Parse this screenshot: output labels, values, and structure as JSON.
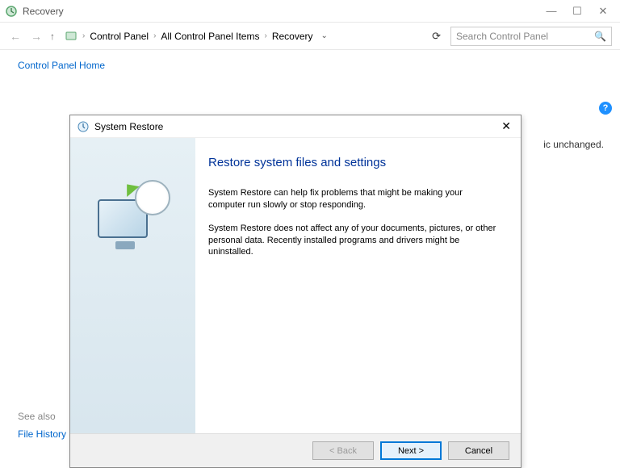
{
  "window": {
    "title": "Recovery",
    "controls": {
      "min": "—",
      "max": "☐",
      "close": "✕"
    }
  },
  "nav": {
    "breadcrumb": [
      "Control Panel",
      "All Control Panel Items",
      "Recovery"
    ],
    "search_placeholder": "Search Control Panel"
  },
  "left": {
    "home": "Control Panel Home",
    "see_also": "See also",
    "file_history": "File History"
  },
  "background_text": "ic unchanged.",
  "help_glyph": "?",
  "dialog": {
    "title": "System Restore",
    "heading": "Restore system files and settings",
    "para1": "System Restore can help fix problems that might be making your computer run slowly or stop responding.",
    "para2": "System Restore does not affect any of your documents, pictures, or other personal data. Recently installed programs and drivers might be uninstalled.",
    "buttons": {
      "back": "< Back",
      "next": "Next >",
      "cancel": "Cancel"
    },
    "close": "✕"
  }
}
